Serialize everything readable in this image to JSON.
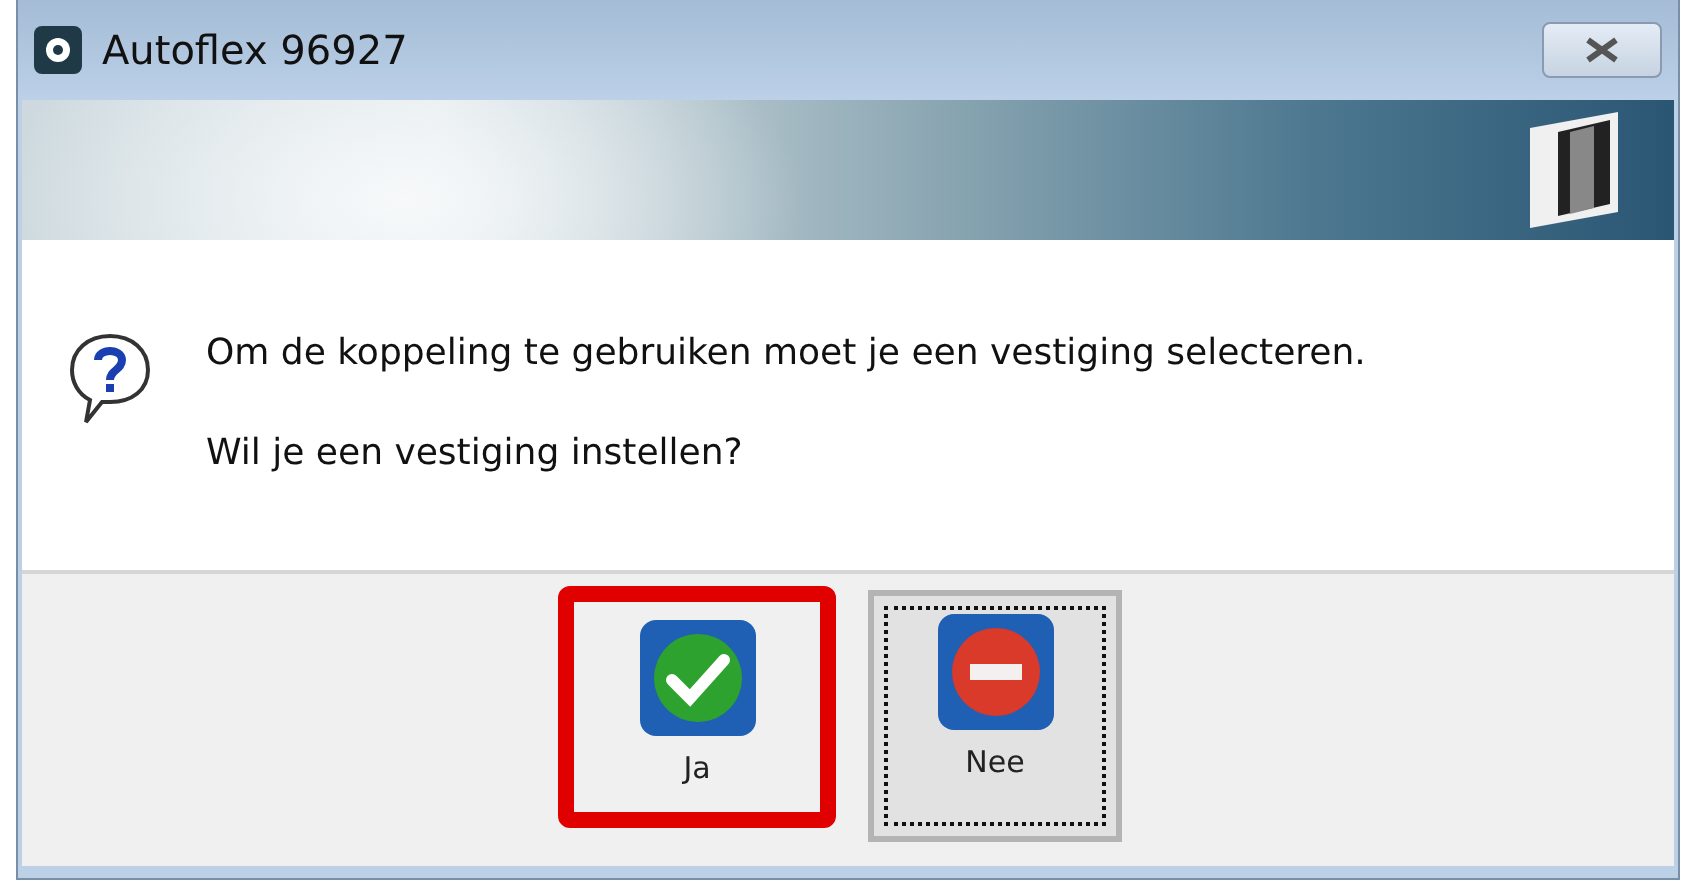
{
  "window": {
    "title": "Autoflex 96927"
  },
  "message": {
    "lines": [
      "Om de koppeling te gebruiken moet je een vestiging selecteren.",
      "Wil je een vestiging instellen?"
    ]
  },
  "buttons": [
    {
      "label": "Ja",
      "kind": "yes",
      "focused": false,
      "highlighted": true
    },
    {
      "label": "Nee",
      "kind": "no",
      "focused": true,
      "highlighted": false
    }
  ]
}
